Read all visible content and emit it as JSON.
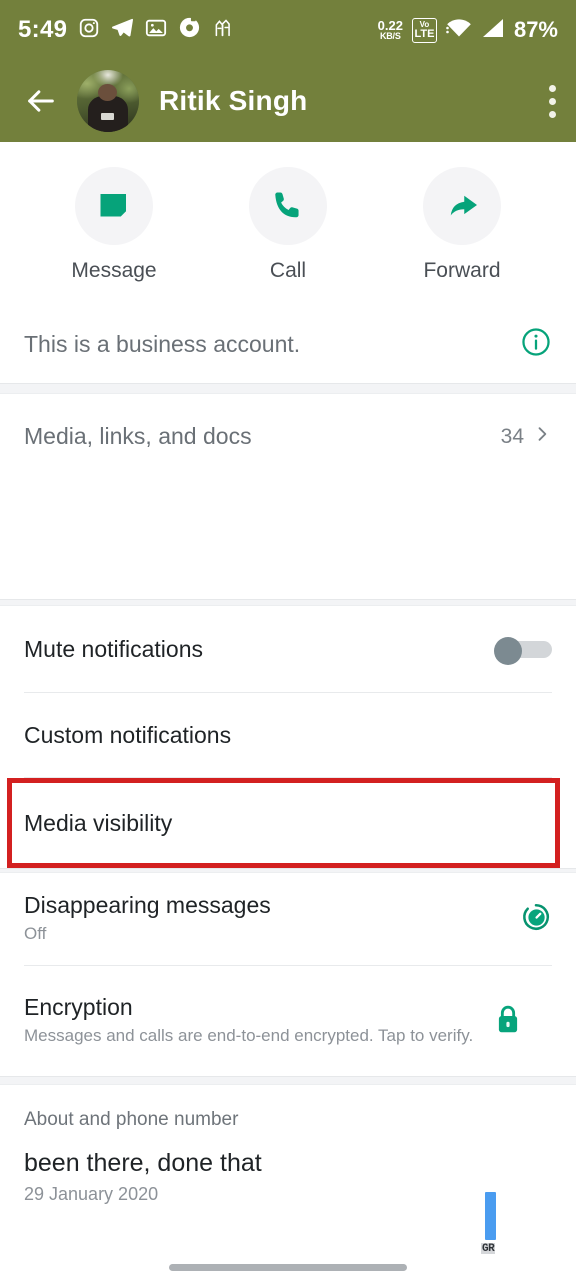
{
  "status_bar": {
    "time": "5:49",
    "left_icons": [
      "instagram-icon",
      "telegram-icon",
      "gallery-icon",
      "circle-record-icon",
      "app-icon"
    ],
    "net_speed_value": "0.22",
    "net_speed_unit": "KB/S",
    "volte_top": "Vo",
    "volte_bottom": "LTE",
    "wifi": "wifi-icon",
    "signal": "signal-icon",
    "battery": "87%",
    "background_color": "#73803c"
  },
  "app_bar": {
    "back": "back-arrow-icon",
    "avatar": "contact-avatar",
    "contact_name": "Ritik Singh",
    "menu": "overflow-menu-icon"
  },
  "actions": [
    {
      "label": "Message",
      "icon": "message-icon"
    },
    {
      "label": "Call",
      "icon": "phone-icon"
    },
    {
      "label": "Forward",
      "icon": "forward-arrow-icon"
    }
  ],
  "business": {
    "label": "This is a business account.",
    "icon": "info-icon"
  },
  "media": {
    "label": "Media, links, and docs",
    "count": "34",
    "chevron": "chevron-right-icon"
  },
  "settings": {
    "mute": {
      "label": "Mute notifications",
      "toggle_state": "off"
    },
    "custom": {
      "label": "Custom notifications"
    },
    "media_visibility": {
      "label": "Media visibility",
      "highlighted": true
    }
  },
  "disappearing": {
    "title": "Disappearing messages",
    "subtitle": "Off",
    "icon": "timer-icon"
  },
  "encryption": {
    "title": "Encryption",
    "subtitle": "Messages and calls are end-to-end encrypted. Tap to verify.",
    "icon": "lock-icon"
  },
  "about": {
    "header": "About and phone number",
    "status_text": "been there, done that",
    "date": "29 January 2020"
  },
  "overlay": {
    "watermark": "GR",
    "highlight_color": "#d32020",
    "scroll_thumb_color": "#4a9cf0"
  },
  "colors": {
    "header": "#73803c",
    "accent_green": "#00a884",
    "text_primary": "#1f2326",
    "text_secondary": "#8d9298"
  }
}
